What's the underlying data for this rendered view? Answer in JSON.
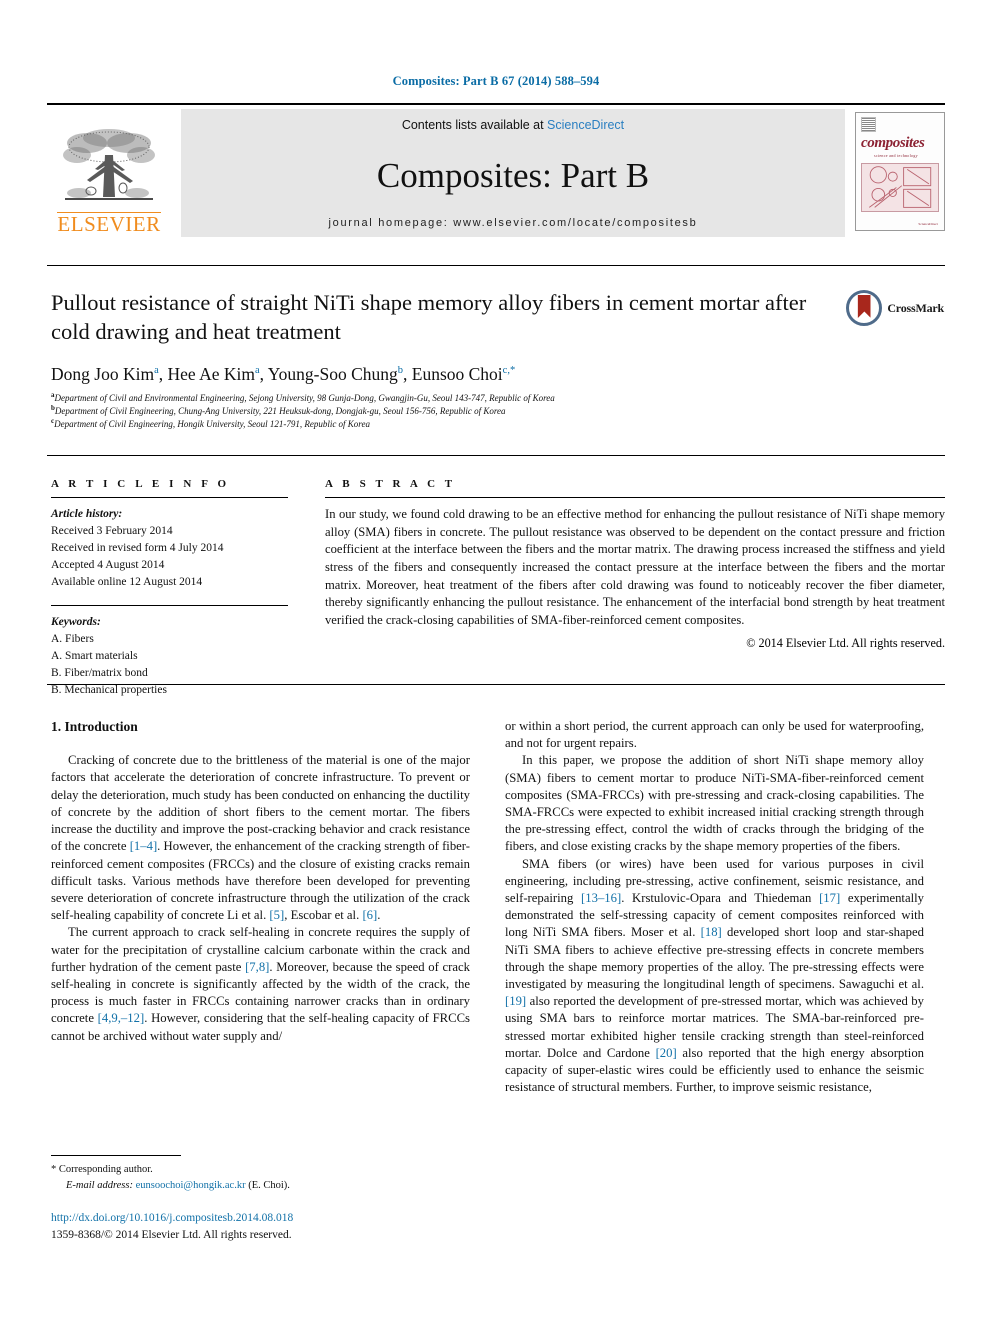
{
  "running_head": "Composites: Part B 67 (2014) 588–594",
  "masthead": {
    "publisher_logo_label": "ELSEVIER",
    "contents_prefix": "Contents lists available at ",
    "contents_link": "ScienceDirect",
    "journal_title": "Composites: Part B",
    "homepage": "journal homepage: www.elsevier.com/locate/compositesb",
    "cover": {
      "word": "composites",
      "subtitle": "science and technology",
      "footer": "ScienceDirect"
    }
  },
  "article": {
    "title": "Pullout resistance of straight NiTi shape memory alloy fibers in cement mortar after cold drawing and heat treatment",
    "crossmark_label": "CrossMark",
    "authors": [
      {
        "name": "Dong Joo Kim",
        "marks": "a",
        "sep": ", "
      },
      {
        "name": "Hee Ae Kim",
        "marks": "a",
        "sep": ", "
      },
      {
        "name": "Young-Soo Chung",
        "marks": "b",
        "sep": ", "
      },
      {
        "name": "Eunsoo Choi",
        "marks": "c,*",
        "sep": ""
      }
    ],
    "affiliations": [
      {
        "mark": "a",
        "text": "Department of Civil and Environmental Engineering, Sejong University, 98 Gunja-Dong, Gwangjin-Gu, Seoul 143-747, Republic of Korea"
      },
      {
        "mark": "b",
        "text": "Department of Civil Engineering, Chung-Ang University, 221 Heuksuk-dong, Dongjak-gu, Seoul 156-756, Republic of Korea"
      },
      {
        "mark": "c",
        "text": "Department of Civil Engineering, Hongik University, Seoul 121-791, Republic of Korea"
      }
    ]
  },
  "article_info": {
    "heading": "A R T I C L E   I N F O",
    "history_label": "Article history:",
    "history": [
      "Received 3 February 2014",
      "Received in revised form 4 July 2014",
      "Accepted 4 August 2014",
      "Available online 12 August 2014"
    ],
    "keywords_label": "Keywords:",
    "keywords": [
      "A. Fibers",
      "A. Smart materials",
      "B. Fiber/matrix bond",
      "B. Mechanical properties"
    ]
  },
  "abstract": {
    "heading": "A B S T R A C T",
    "text": "In our study, we found cold drawing to be an effective method for enhancing the pullout resistance of NiTi shape memory alloy (SMA) fibers in concrete. The pullout resistance was observed to be dependent on the contact pressure and friction coefficient at the interface between the fibers and the mortar matrix. The drawing process increased the stiffness and yield stress of the fibers and consequently increased the contact pressure at the interface between the fibers and the mortar matrix. Moreover, heat treatment of the fibers after cold drawing was found to noticeably recover the fiber diameter, thereby significantly enhancing the pullout resistance. The enhancement of the interfacial bond strength by heat treatment verified the crack-closing capabilities of SMA-fiber-reinforced cement composites.",
    "copyright": "© 2014 Elsevier Ltd. All rights reserved."
  },
  "body": {
    "section_heading": "1. Introduction",
    "left_paragraphs": [
      "Cracking of concrete due to the brittleness of the material is one of the major factors that accelerate the deterioration of concrete infrastructure. To prevent or delay the deterioration, much study has been conducted on enhancing the ductility of concrete by the addition of short fibers to the cement mortar. The fibers increase the ductility and improve the post-cracking behavior and crack resistance of the concrete [1–4]. However, the enhancement of the cracking strength of fiber-reinforced cement composites (FRCCs) and the closure of existing cracks remain difficult tasks. Various methods have therefore been developed for preventing severe deterioration of concrete infrastructure through the utilization of the crack self-healing capability of concrete Li et al. [5], Escobar et al. [6].",
      "The current approach to crack self-healing in concrete requires the supply of water for the precipitation of crystalline calcium carbonate within the crack and further hydration of the cement paste [7,8]. Moreover, because the speed of crack self-healing in concrete is significantly affected by the width of the crack, the process is much faster in FRCCs containing narrower cracks than in ordinary concrete [4,9,–12]. However, considering that the self-healing capacity of FRCCs cannot be archived without water supply and/"
    ],
    "right_paragraphs": [
      "or within a short period, the current approach can only be used for waterproofing, and not for urgent repairs.",
      "In this paper, we propose the addition of short NiTi shape memory alloy (SMA) fibers to cement mortar to produce NiTi-SMA-fiber-reinforced cement composites (SMA-FRCCs) with pre-stressing and crack-closing capabilities. The SMA-FRCCs were expected to exhibit increased initial cracking strength through the pre-stressing effect, control the width of cracks through the bridging of the fibers, and close existing cracks by the shape memory properties of the fibers.",
      "SMA fibers (or wires) have been used for various purposes in civil engineering, including pre-stressing, active confinement, seismic resistance, and self-repairing [13–16]. Krstulovic-Opara and Thiedeman [17] experimentally demonstrated the self-stressing capacity of cement composites reinforced with long NiTi SMA fibers. Moser et al. [18] developed short loop and star-shaped NiTi SMA fibers to achieve effective pre-stressing effects in concrete members through the shape memory properties of the alloy. The pre-stressing effects were investigated by measuring the longitudinal length of specimens. Sawaguchi et al. [19] also reported the development of pre-stressed mortar, which was achieved by using SMA bars to reinforce mortar matrices. The SMA-bar-reinforced pre-stressed mortar exhibited higher tensile cracking strength than steel-reinforced mortar. Dolce and Cardone [20] also reported that the high energy absorption capacity of super-elastic wires could be efficiently used to enhance the seismic resistance of structural members. Further, to improve seismic resistance,"
    ]
  },
  "footnote": {
    "corresponding": "* Corresponding author.",
    "email_label": "E-mail address:",
    "email": "eunsoochoi@hongik.ac.kr",
    "email_suffix": "(E. Choi)."
  },
  "page_footer": {
    "doi": "http://dx.doi.org/10.1016/j.compositesb.2014.08.018",
    "issn_line": "1359-8368/© 2014 Elsevier Ltd. All rights reserved."
  },
  "colors": {
    "link_blue": "#1271a8",
    "header_blue": "#0a6ca5",
    "elsevier_orange": "#F08C1E",
    "cover_maroon": "#8c2233"
  }
}
